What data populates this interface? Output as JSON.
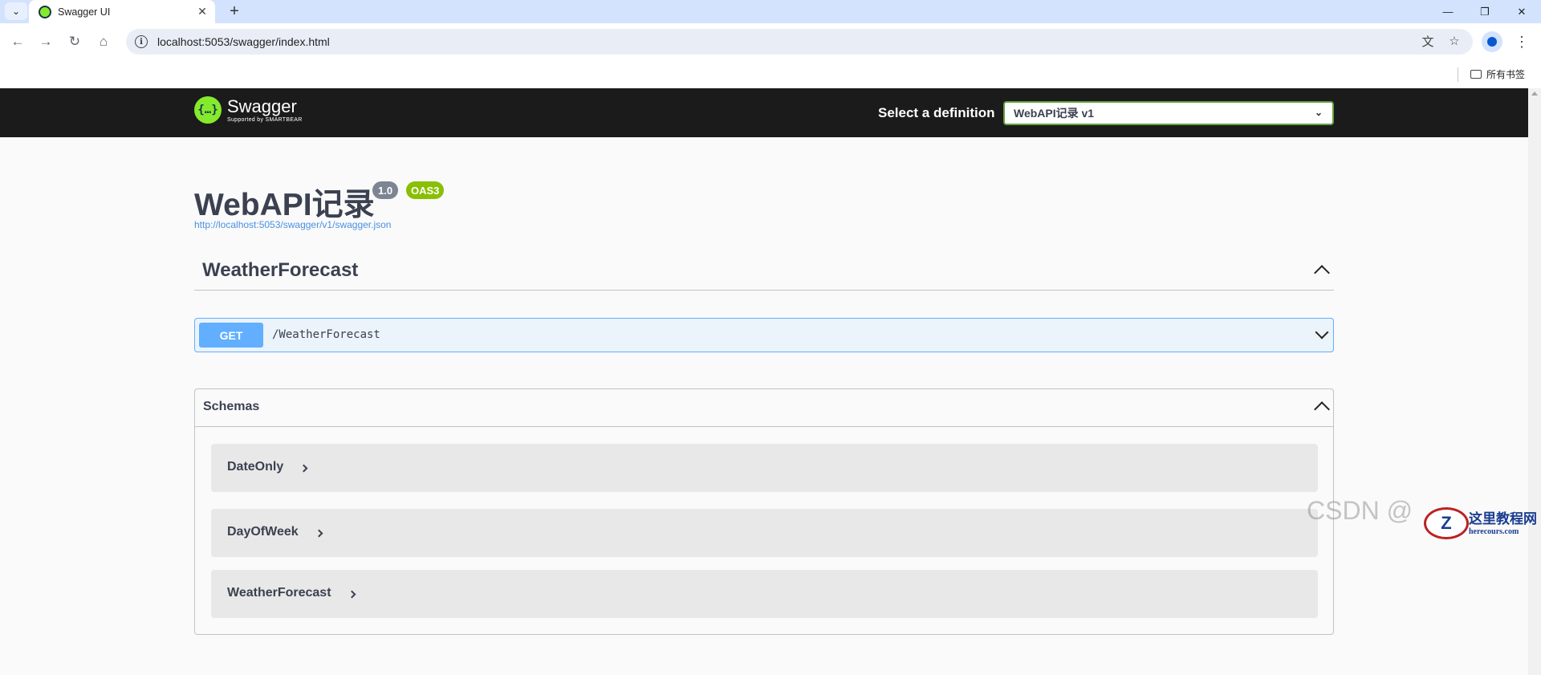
{
  "browser": {
    "tab_title": "Swagger UI",
    "url": "localhost:5053/swagger/index.html",
    "bookmarks_folder": "所有书签"
  },
  "topbar": {
    "logo_name": "Swagger",
    "logo_sub": "Supported by SMARTBEAR",
    "definition_label": "Select a definition",
    "definition_selected": "WebAPI记录 v1"
  },
  "info": {
    "title": "WebAPI记录",
    "version": "1.0",
    "oas": "OAS3",
    "spec_link": "http://localhost:5053/swagger/v1/swagger.json"
  },
  "tags": [
    {
      "name": "WeatherForecast",
      "operations": [
        {
          "method": "GET",
          "path": "/WeatherForecast"
        }
      ]
    }
  ],
  "schemas": {
    "title": "Schemas",
    "models": [
      "DateOnly",
      "DayOfWeek",
      "WeatherForecast"
    ]
  },
  "watermark": {
    "text": "CSDN @",
    "site_cn": "这里教程网",
    "site_url": "herecours.com"
  },
  "colors": {
    "topbar": "#1b1b1b",
    "get_method": "#61affe",
    "oas_badge": "#89bf04",
    "version_badge": "#7d8492",
    "select_border": "#62a03f"
  }
}
